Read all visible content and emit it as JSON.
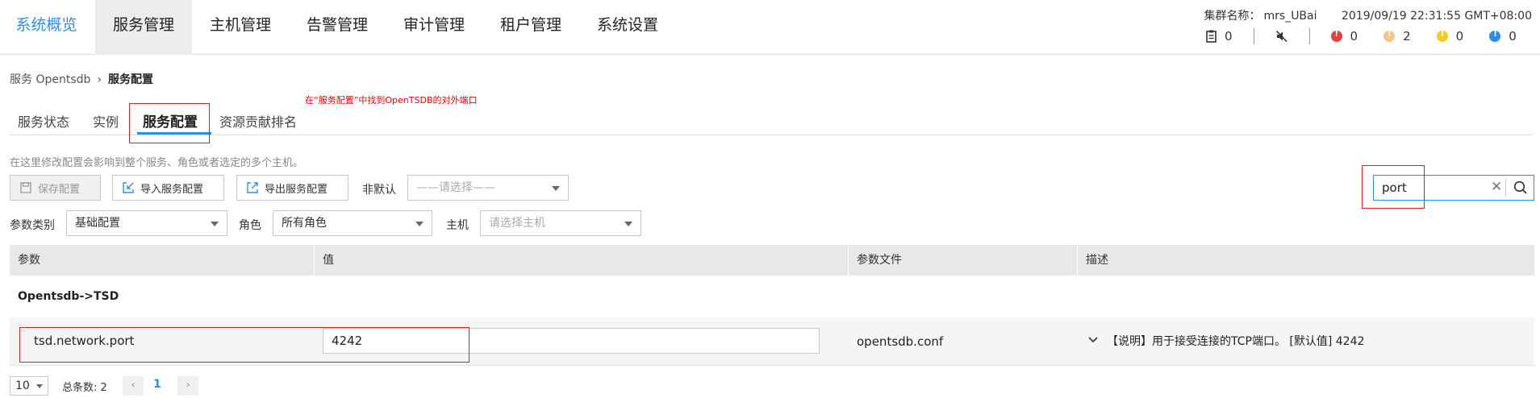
{
  "nav": {
    "items": [
      {
        "label": "系统概览",
        "name": "nav-overview"
      },
      {
        "label": "服务管理",
        "name": "nav-services"
      },
      {
        "label": "主机管理",
        "name": "nav-hosts"
      },
      {
        "label": "告警管理",
        "name": "nav-alarms"
      },
      {
        "label": "审计管理",
        "name": "nav-audit"
      },
      {
        "label": "租户管理",
        "name": "nav-tenants"
      },
      {
        "label": "系统设置",
        "name": "nav-settings"
      }
    ],
    "cluster_label": "集群名称：",
    "cluster_name": "mrs_UBai",
    "datetime": "2019/09/19 22:31:55 GMT+08:00",
    "status": {
      "tasks": "0",
      "critical": "0",
      "major": "2",
      "minor": "0",
      "warning": "0"
    },
    "colors": {
      "active": "#2e8ee6",
      "critical": "#e84040",
      "major": "#f5c48a",
      "minor": "#f5cc1f",
      "warning": "#2e8ee6"
    }
  },
  "breadcrumb": {
    "parent": "服务 Opentsdb",
    "current": "服务配置"
  },
  "annotation": "在“服务配置”中找到OpenTSDB的对外端口",
  "tabs": [
    "服务状态",
    "实例",
    "服务配置",
    "资源贡献排名"
  ],
  "hint": "在这里修改配置会影响到整个服务、角色或者选定的多个主机。",
  "toolbar": {
    "save": "保存配置",
    "import": "导入服务配置",
    "export": "导出服务配置",
    "non_default_label": "非默认",
    "non_default_placeholder": "——请选择——",
    "category_label": "参数类别",
    "category_value": "基础配置",
    "role_label": "角色",
    "role_value": "所有角色",
    "host_label": "主机",
    "host_placeholder": "请选择主机",
    "search_value": "port"
  },
  "table": {
    "headers": [
      "参数",
      "值",
      "参数文件",
      "描述"
    ],
    "group": "Opentsdb->TSD",
    "rows": [
      {
        "param": "tsd.network.port",
        "value": "4242",
        "file": "opentsdb.conf",
        "desc": "【说明】用于接受连接的TCP端口。 [默认值] 4242"
      }
    ]
  },
  "pagination": {
    "page_size": "10",
    "total": "总条数: 2",
    "current_page": "1"
  }
}
